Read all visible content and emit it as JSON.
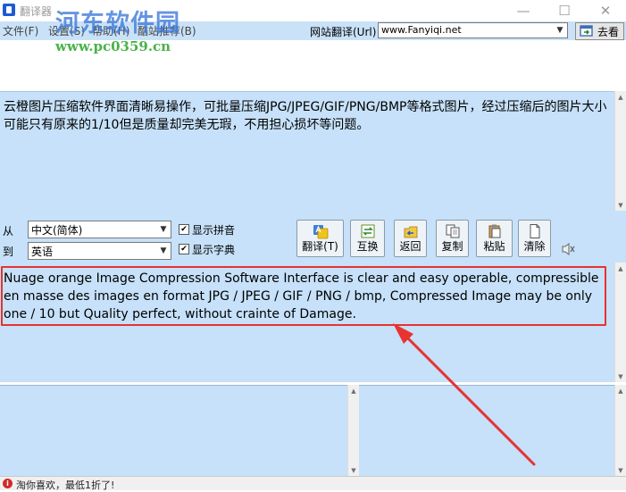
{
  "window": {
    "title": "翻译器",
    "watermark_name": "河东软件园",
    "watermark_url": "www.pc0359.cn",
    "controls": {
      "minimize": "—",
      "maximize": "☐",
      "close": "✕"
    }
  },
  "menu": {
    "items": [
      "文件(F)",
      "设置(S)",
      "帮助(H)",
      "酷站推荐(B)"
    ],
    "url_label": "网站翻译(Url)",
    "url_value": "www.Fanyiqi.net",
    "go_label": "去看"
  },
  "source": {
    "text": "云橙图片压缩软件界面清晰易操作，可批量压缩JPG/JPEG/GIF/PNG/BMP等格式图片，经过压缩后的图片大小可能只有原来的1/10但是质量却完美无瑕，不用担心损坏等问题。"
  },
  "controls": {
    "from_label": "从",
    "to_label": "到",
    "from_lang": "中文(简体)",
    "to_lang": "英语",
    "show_pinyin": "显示拼音",
    "show_dictionary": "显示字典",
    "show_pinyin_checked": true,
    "show_dictionary_checked": true,
    "buttons": {
      "translate": "翻译(T)",
      "swap": "互换",
      "back": "返回",
      "copy": "复制",
      "paste": "粘贴",
      "clear": "清除"
    }
  },
  "target": {
    "text": "Nuage orange Image Compression Software Interface is clear and easy operable, compressible en masse des images en format JPG / JPEG / GIF / PNG / bmp, Compressed Image may be only one / 10 but Quality perfect, without crainte of Damage."
  },
  "status": {
    "text": "淘你喜欢，最低1折了!"
  },
  "colors": {
    "pane_bg": "#c6e1f9",
    "menu_bg": "#c9e2f8",
    "annotation": "#e8332f"
  }
}
